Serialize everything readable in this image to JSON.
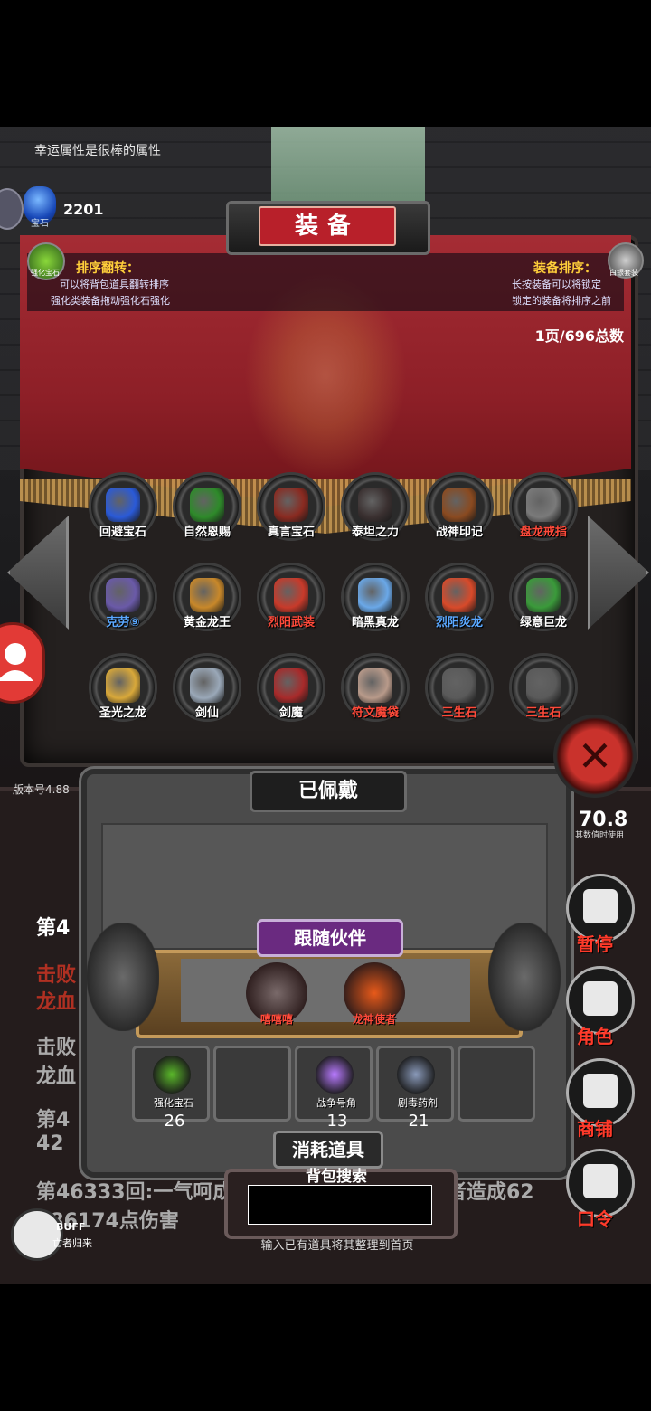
{
  "hint_text": "幸运属性是很棒的属性",
  "gem_count": "2201",
  "gem_label": "宝石",
  "panel": {
    "title": "装备",
    "left_corner_label": "强化宝石",
    "right_corner_label": "白银套装",
    "sort_flip": {
      "title": "排序翻转：",
      "desc1": "可以将背包道具翻转排序",
      "desc2": "强化类装备拖动强化石强化"
    },
    "equip_sort": {
      "title": "装备排序：",
      "desc1": "长按装备可以将锁定",
      "desc2": "锁定的装备将排序之前"
    },
    "page_count": "1页/696总数"
  },
  "equipment": [
    {
      "label": "回避宝石",
      "color": "#ffffff",
      "icon": "blue-orb-icon",
      "swatch": "#2a5ad8"
    },
    {
      "label": "自然恩赐",
      "color": "#ffffff",
      "icon": "green-ore-icon",
      "swatch": "#2e8a2a"
    },
    {
      "label": "真言宝石",
      "color": "#ffffff",
      "icon": "rune-stone-icon",
      "swatch": "#8a2a20"
    },
    {
      "label": "泰坦之力",
      "color": "#ffffff",
      "icon": "titan-ore-icon",
      "swatch": "#3a3030"
    },
    {
      "label": "战神印记",
      "color": "#ffffff",
      "icon": "war-mark-icon",
      "swatch": "#8a4a20"
    },
    {
      "label": "盘龙戒指",
      "color": "#ff4a3a",
      "icon": "dragon-ring-icon",
      "swatch": "#7a7a7a"
    },
    {
      "label": "克劳⑨",
      "color": "#5aa8ff",
      "icon": "claw-hero-icon",
      "swatch": "#6a5aa8"
    },
    {
      "label": "黄金龙王",
      "color": "#ffffff",
      "icon": "golden-dragon-icon",
      "swatch": "#c8882a"
    },
    {
      "label": "烈阳武装",
      "color": "#ff4a3a",
      "icon": "sun-armor-icon",
      "swatch": "#c83a2a"
    },
    {
      "label": "暗黑真龙",
      "color": "#ffffff",
      "icon": "dark-dragon-icon",
      "swatch": "#6aa8e8"
    },
    {
      "label": "烈阳炎龙",
      "color": "#5aa8ff",
      "icon": "fire-dragon-icon",
      "swatch": "#d84a2a"
    },
    {
      "label": "绿意巨龙",
      "color": "#ffffff",
      "icon": "green-dragon-icon",
      "swatch": "#3a9a3a"
    },
    {
      "label": "圣光之龙",
      "color": "#ffffff",
      "icon": "holy-dragon-icon",
      "swatch": "#d8a83a"
    },
    {
      "label": "剑仙",
      "color": "#ffffff",
      "icon": "sword-immortal-icon",
      "swatch": "#9aa8b8"
    },
    {
      "label": "剑魔",
      "color": "#ffffff",
      "icon": "sword-demon-icon",
      "swatch": "#a82a2a"
    },
    {
      "label": "符文魔袋",
      "color": "#ff4a3a",
      "icon": "rune-bag-icon",
      "swatch": "#b89a8a"
    },
    {
      "label": "三生石",
      "color": "#ff4a3a",
      "icon": "chained-stone-icon",
      "swatch": "#5a5a5a"
    },
    {
      "label": "三生石",
      "color": "#ff4a3a",
      "icon": "chained-stone-icon",
      "swatch": "#5a5a5a"
    }
  ],
  "version": "版本号4.88",
  "right_stat": {
    "value": "70.8",
    "label": "其数值时使用"
  },
  "worn": {
    "title": "已佩戴"
  },
  "follow": {
    "title": "跟随伙伴",
    "pets": [
      {
        "label": "嘻嘻嘻",
        "icon": "knight-pet-icon",
        "swatch": "#7a6a6a"
      },
      {
        "label": "龙神使者",
        "icon": "fire-spirit-pet-icon",
        "swatch": "#e85a1a"
      }
    ]
  },
  "consumables": {
    "title": "消耗道具",
    "items": [
      {
        "label": "强化宝石",
        "count": "26",
        "icon": "enhance-gem-icon",
        "swatch": "#5ab82a"
      },
      {
        "label": "",
        "count": "",
        "icon": "",
        "swatch": ""
      },
      {
        "label": "战争号角",
        "count": "13",
        "icon": "war-horn-icon",
        "swatch": "#b87aff"
      },
      {
        "label": "剧毒药剂",
        "count": "21",
        "icon": "poison-potion-icon",
        "swatch": "#8a9aba"
      },
      {
        "label": "",
        "count": "",
        "icon": "",
        "swatch": ""
      }
    ]
  },
  "search": {
    "title": "背包搜索",
    "hint": "输入已有道具将其整理到首页",
    "value": ""
  },
  "log": {
    "line1": "第4",
    "line2": "击败",
    "line3": "龙血",
    "line4": "击败",
    "line5": "龙血",
    "line6": "第4",
    "line7": "42",
    "line8": "第46333回:一气呵成王使者",
    "line8b": "龙神使者造成62",
    "line9": "286174点伤害"
  },
  "side_menu": [
    {
      "label": "暂停",
      "icon": "dice-icon"
    },
    {
      "label": "角色",
      "icon": "hooded-figure-icon"
    },
    {
      "label": "商铺",
      "icon": "shop-icon"
    },
    {
      "label": "口令",
      "icon": "scroll-icon"
    }
  ],
  "buff": {
    "label": "BUFF",
    "sub": "亡者归来"
  }
}
